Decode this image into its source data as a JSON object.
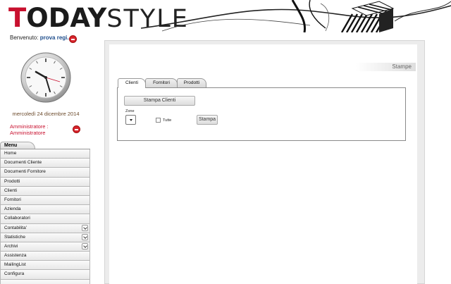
{
  "header": {
    "logo_bold_first": "T",
    "logo_bold_rest": "ODAY",
    "logo_thin": "STYLE"
  },
  "user": {
    "welcome_label": "Benvenuto:",
    "name": "prova regi...",
    "date": "mercoledì 24 dicembre 2014",
    "role_line1": "Amministratore :",
    "role_line2": "Amministratore"
  },
  "menu": {
    "title": "Menu",
    "items": [
      {
        "label": "Home",
        "expandable": false
      },
      {
        "label": "Documenti Cliente",
        "expandable": false
      },
      {
        "label": "Documenti Fornitore",
        "expandable": false
      },
      {
        "label": "Prodotti",
        "expandable": false
      },
      {
        "label": "Clienti",
        "expandable": false
      },
      {
        "label": "Fornitori",
        "expandable": false
      },
      {
        "label": "Azienda",
        "expandable": false
      },
      {
        "label": "Collaboratori",
        "expandable": false
      },
      {
        "label": "Contabilita'",
        "expandable": true
      },
      {
        "label": "Statistiche",
        "expandable": true
      },
      {
        "label": "Archivi",
        "expandable": true
      },
      {
        "label": "Assistenza",
        "expandable": false
      },
      {
        "label": "MailingList",
        "expandable": false
      },
      {
        "label": "Configura",
        "expandable": false
      },
      {
        "label": "",
        "expandable": false
      }
    ]
  },
  "page": {
    "title": "Stampe",
    "tabs": [
      {
        "label": "Clienti",
        "active": true
      },
      {
        "label": "Fornitori",
        "active": false
      },
      {
        "label": "Prodotti",
        "active": false
      }
    ],
    "form": {
      "stampa_clienti_label": "Stampa Clienti",
      "zone_label": "Zone",
      "tutte_label": "Tutte",
      "stampa_label": "Stampa"
    }
  },
  "colors": {
    "accent_red": "#c8102e",
    "user_blue": "#1f4e8c"
  }
}
